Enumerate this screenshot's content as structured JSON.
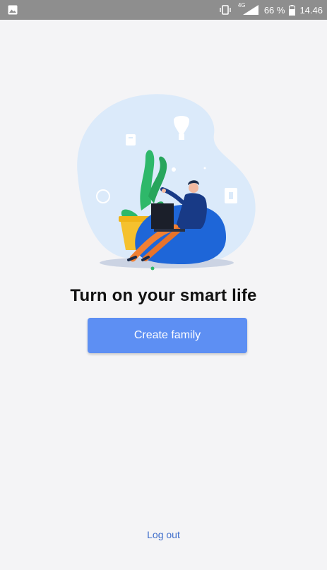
{
  "status_bar": {
    "network": "4G",
    "battery": "66 %",
    "time": "14.46",
    "icons": [
      "image-icon",
      "vibrate-icon",
      "signal-icon",
      "battery-icon"
    ]
  },
  "main": {
    "headline": "Turn on your smart life",
    "create_family_label": "Create family",
    "logout_label": "Log out"
  },
  "colors": {
    "primary": "#5d8ff3",
    "link": "#3f6ecb",
    "background": "#f4f4f6",
    "status_bar": "#8e8e8e",
    "bean_bag": "#1e66d8",
    "blob": "#dbeafa"
  },
  "illustration": {
    "icons": [
      "lightbulb-icon",
      "plant-icon",
      "person-icon",
      "laptop-icon",
      "bean-bag-icon",
      "switch-icon",
      "socket-icon"
    ]
  }
}
